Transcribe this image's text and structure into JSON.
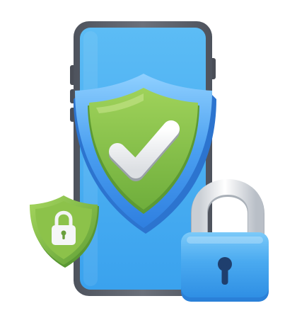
{
  "illustration": {
    "icons": [
      "smartphone-icon",
      "shield-check-icon",
      "small-shield-lock-icon",
      "padlock-icon"
    ],
    "colors": {
      "phone_frame": "#5f6470",
      "phone_screen": "#4db1f2",
      "shield_outer": "#3d8ee8",
      "shield_inner": "#8bc34a",
      "check": "#f2f2f2",
      "padlock_body": "#4aa9ef",
      "padlock_shackle": "#e9ecef"
    }
  }
}
